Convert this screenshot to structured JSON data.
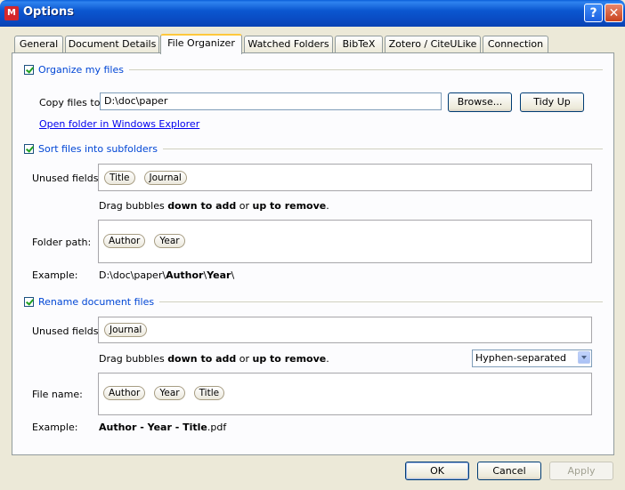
{
  "window": {
    "title": "Options",
    "app_icon": "M",
    "help": "?",
    "close": "✕"
  },
  "tabs": [
    "General",
    "Document Details",
    "File Organizer",
    "Watched Folders",
    "BibTeX",
    "Zotero / CiteULike",
    "Connection"
  ],
  "active_tab": "File Organizer",
  "organize": {
    "label": "Organize my files",
    "checked": true,
    "copy_label": "Copy files to:",
    "copy_value": "D:\\doc\\paper",
    "browse": "Browse...",
    "tidy": "Tidy Up",
    "open_link": "Open folder in Windows Explorer"
  },
  "subfolders": {
    "label": "Sort files into subfolders",
    "checked": true,
    "unused_label": "Unused fields:",
    "unused": [
      "Title",
      "Journal"
    ],
    "hint_pre": "Drag bubbles ",
    "hint_b1": "down to add",
    "hint_mid": " or ",
    "hint_b2": "up to remove",
    "hint_post": ".",
    "path_label": "Folder path:",
    "path": [
      "Author",
      "Year"
    ],
    "example_label": "Example:",
    "example_pre": "D:\\doc\\paper\\",
    "example_b1": "Author",
    "example_sep": "\\",
    "example_b2": "Year",
    "example_post": "\\"
  },
  "rename": {
    "label": "Rename document files",
    "checked": true,
    "unused_label": "Unused fields:",
    "unused": [
      "Journal"
    ],
    "hint_pre": "Drag bubbles ",
    "hint_b1": "down to add",
    "hint_mid": " or ",
    "hint_b2": "up to remove",
    "hint_post": ".",
    "separator": "Hyphen-separated",
    "name_label": "File name:",
    "name": [
      "Author",
      "Year",
      "Title"
    ],
    "example_label": "Example:",
    "example_bold": "Author - Year - Title",
    "example_ext": ".pdf"
  },
  "footer": {
    "ok": "OK",
    "cancel": "Cancel",
    "apply": "Apply"
  }
}
